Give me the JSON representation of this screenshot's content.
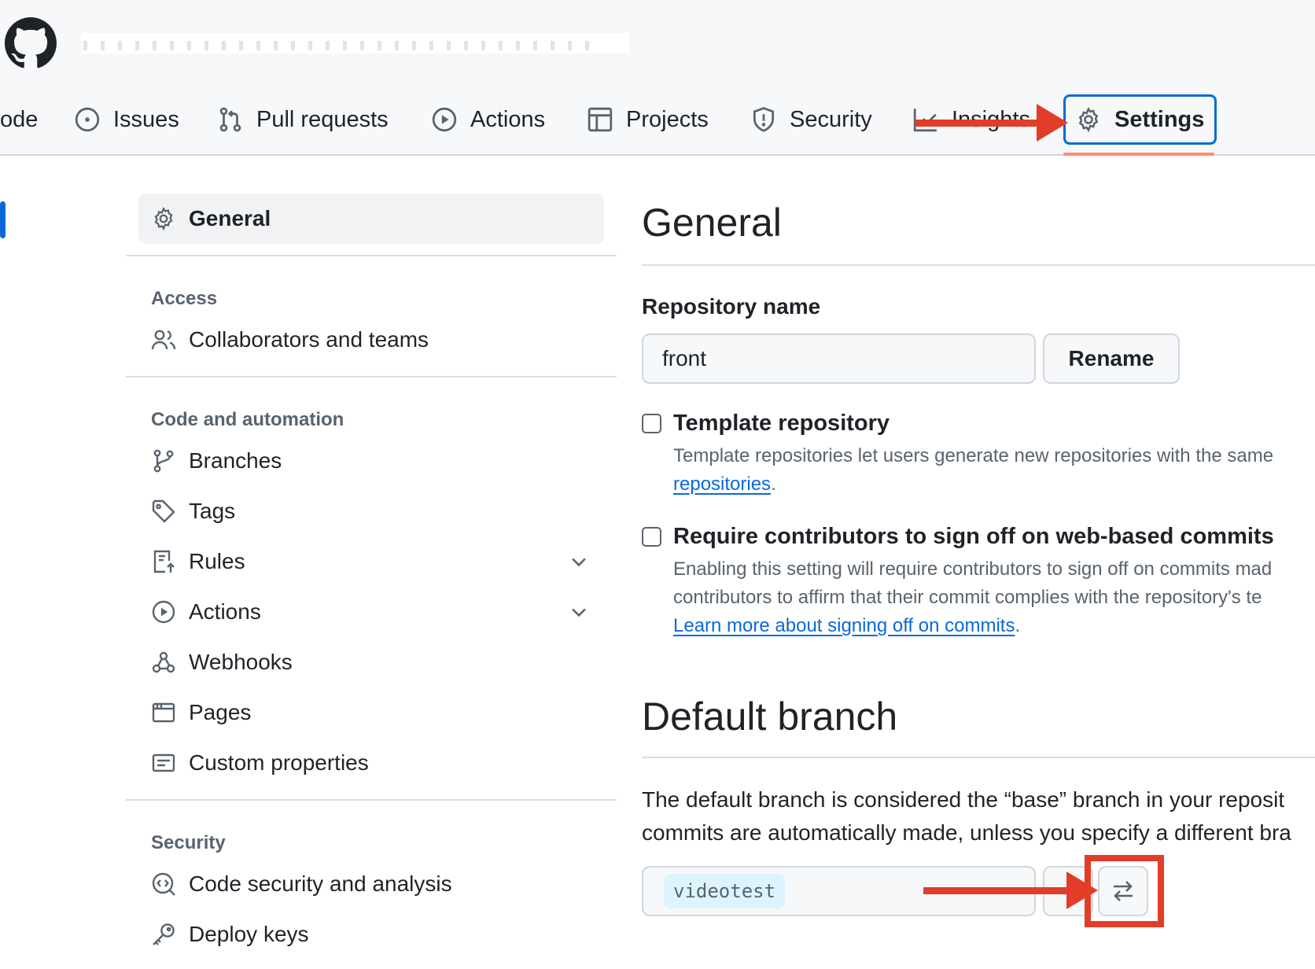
{
  "header": {
    "tabs": [
      {
        "label": "ode",
        "icon": "code-icon"
      },
      {
        "label": "Issues",
        "icon": "issue-opened-icon"
      },
      {
        "label": "Pull requests",
        "icon": "git-pull-request-icon"
      },
      {
        "label": "Actions",
        "icon": "play-icon"
      },
      {
        "label": "Projects",
        "icon": "table-icon"
      },
      {
        "label": "Security",
        "icon": "shield-icon"
      },
      {
        "label": "Insights",
        "icon": "graph-icon"
      },
      {
        "label": "Settings",
        "icon": "gear-icon",
        "selected": true
      }
    ]
  },
  "sidebar": {
    "general": "General",
    "sections": [
      {
        "heading": "Access",
        "items": [
          "Collaborators and teams"
        ]
      },
      {
        "heading": "Code and automation",
        "items": [
          "Branches",
          "Tags",
          "Rules",
          "Actions",
          "Webhooks",
          "Pages",
          "Custom properties"
        ]
      },
      {
        "heading": "Security",
        "items": [
          "Code security and analysis",
          "Deploy keys"
        ]
      }
    ]
  },
  "main": {
    "title": "General",
    "repo_name_label": "Repository name",
    "repo_name_value": "front",
    "rename_button": "Rename",
    "template": {
      "title": "Template repository",
      "desc_line1": "Template repositories let users generate new repositories with the same",
      "link": "repositories",
      "link_suffix": "."
    },
    "signoff": {
      "title": "Require contributors to sign off on web-based commits",
      "desc_line1": "Enabling this setting will require contributors to sign off on commits mad",
      "desc_line2": "contributors to affirm that their commit complies with the repository's te",
      "link": "Learn more about signing off on commits",
      "link_suffix": "."
    },
    "default_branch": {
      "title": "Default branch",
      "line1": "The default branch is considered the “base” branch in your reposit",
      "line2": "commits are automatically made, unless you specify a different bra",
      "branch": "videotest"
    }
  },
  "colors": {
    "accent": "#0969da",
    "annotation": "#e23d28",
    "tab_underline": "#fd8c73"
  }
}
